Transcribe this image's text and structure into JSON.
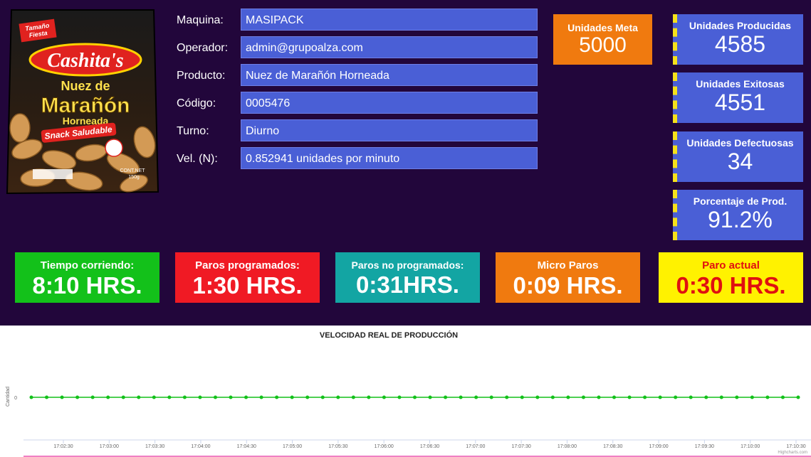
{
  "product": {
    "badge": "Tamaño Fiesta",
    "brand": "Cashita's",
    "line1": "Nuez de",
    "line2": "Marañón",
    "line3": "Horneada",
    "ribbon": "Snack Saludable",
    "net": "CONT.NET 150g"
  },
  "info": {
    "maquina_label": "Maquina:",
    "maquina_value": "MASIPACK",
    "operador_label": "Operador:",
    "operador_value": "admin@grupoalza.com",
    "producto_label": "Producto:",
    "producto_value": "Nuez de Marañón Horneada",
    "codigo_label": "Código:",
    "codigo_value": "0005476",
    "turno_label": "Turno:",
    "turno_value": "Diurno",
    "vel_label": "Vel. (N):",
    "vel_value": "0.852941 unidades por minuto"
  },
  "meta": {
    "title": "Unidades Meta",
    "value": "5000"
  },
  "stats": {
    "producidas_title": "Unidades Producidas",
    "producidas_value": "4585",
    "exitosas_title": "Unidades Exitosas",
    "exitosas_value": "4551",
    "defectuosas_title": "Unidades Defectuosas",
    "defectuosas_value": "34",
    "porcentaje_title": "Porcentaje de Prod.",
    "porcentaje_value": "91.2%"
  },
  "kpis": {
    "corriendo_title": "Tiempo corriendo:",
    "corriendo_value": "8:10 HRS.",
    "programados_title": "Paros programados:",
    "programados_value": "1:30 HRS.",
    "noprog_title": "Paros no programados:",
    "noprog_value": "0:31HRS.",
    "micro_title": "Micro Paros",
    "micro_value": "0:09 HRS.",
    "actual_title": "Paro actual",
    "actual_value": "0:30 HRS."
  },
  "colors": {
    "panel_bg": "#22063b",
    "field_blue": "#4a5fd6",
    "orange": "#f07a0f",
    "green": "#13c11a",
    "red": "#f01a24",
    "teal": "#13a5a3",
    "yellow": "#fff200",
    "series": "#13c11a"
  },
  "chart_data": {
    "type": "line",
    "title": "VELOCIDAD REAL DE PRODUCCIÓN",
    "ylabel": "Cantidad",
    "xlabel": "",
    "y_ticks": [
      "0"
    ],
    "x_ticks": [
      "17:02:30",
      "17:03:00",
      "17:03:30",
      "17:04:00",
      "17:04:30",
      "17:05:00",
      "17:05:30",
      "17:06:00",
      "17:06:30",
      "17:07:00",
      "17:07:30",
      "17:08:00",
      "17:08:30",
      "17:09:00",
      "17:09:30",
      "17:10:00",
      "17:10:30"
    ],
    "series": [
      {
        "values": [
          0,
          0,
          0,
          0,
          0,
          0,
          0,
          0,
          0,
          0,
          0,
          0,
          0,
          0,
          0,
          0,
          0,
          0,
          0,
          0,
          0,
          0,
          0,
          0,
          0,
          0,
          0,
          0,
          0,
          0,
          0,
          0,
          0,
          0,
          0,
          0,
          0,
          0,
          0,
          0,
          0,
          0,
          0,
          0,
          0,
          0,
          0,
          0,
          0,
          0,
          0
        ]
      }
    ],
    "credit": "Highcharts.com"
  }
}
